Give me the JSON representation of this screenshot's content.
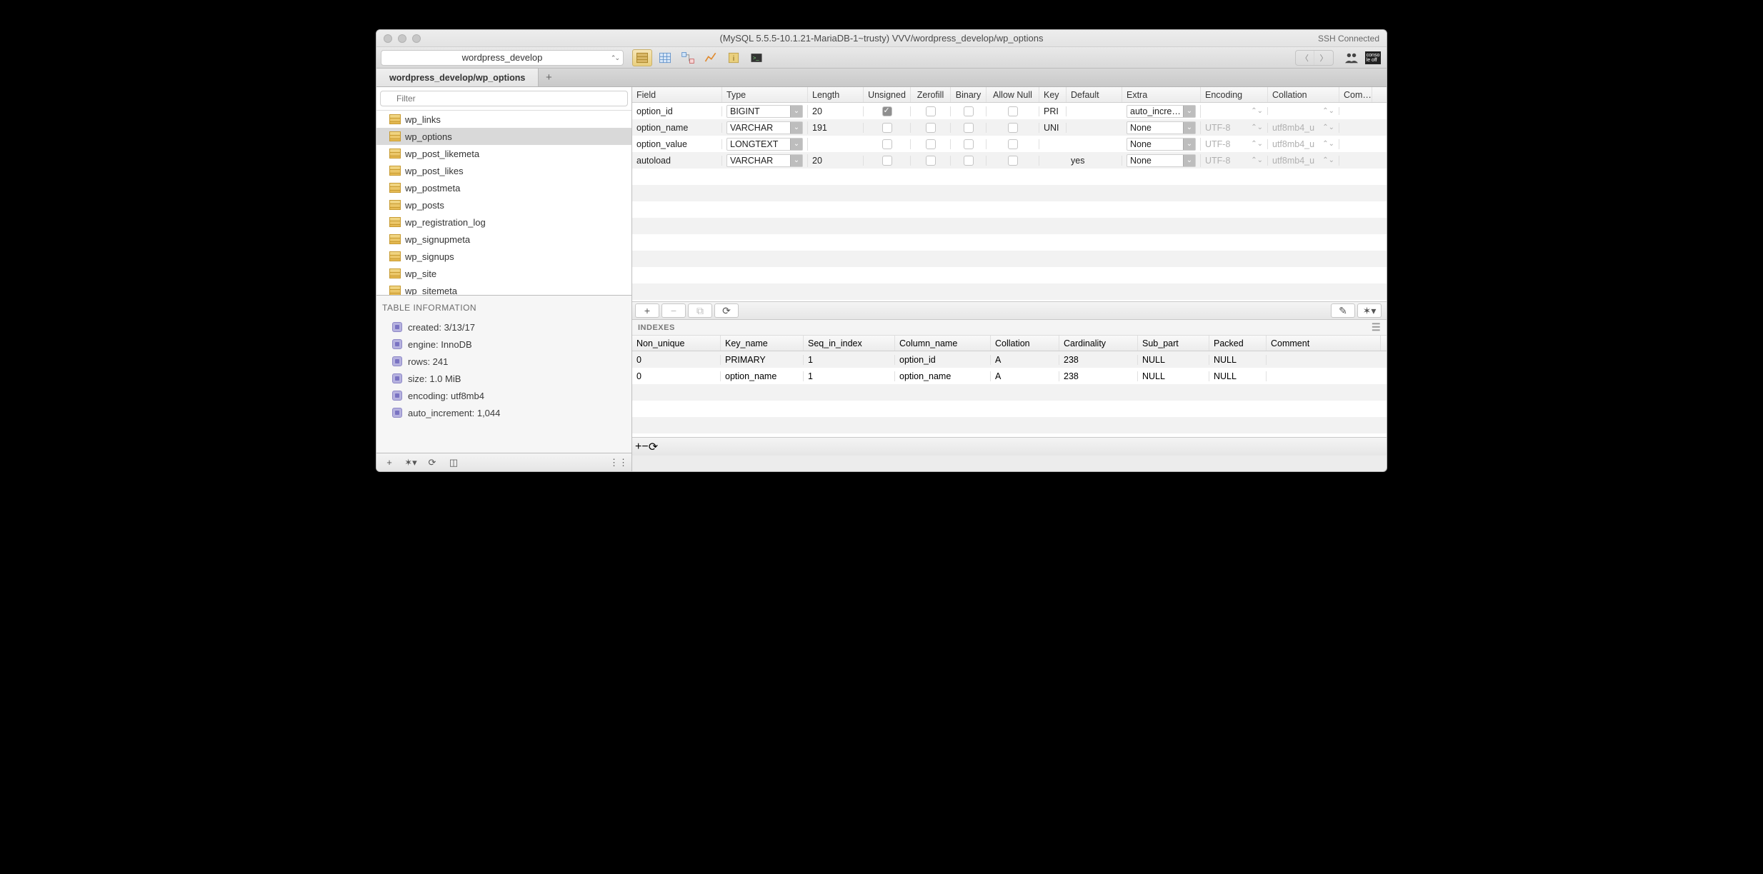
{
  "window": {
    "title": "(MySQL 5.5.5-10.1.21-MariaDB-1~trusty) VVV/wordpress_develop/wp_options",
    "ssh_status": "SSH Connected"
  },
  "toolbar": {
    "db_selected": "wordpress_develop"
  },
  "tab": {
    "label": "wordpress_develop/wp_options"
  },
  "sidebar": {
    "filter_placeholder": "Filter",
    "tables": [
      {
        "name": "wp_links",
        "selected": false
      },
      {
        "name": "wp_options",
        "selected": true
      },
      {
        "name": "wp_post_likemeta",
        "selected": false
      },
      {
        "name": "wp_post_likes",
        "selected": false
      },
      {
        "name": "wp_postmeta",
        "selected": false
      },
      {
        "name": "wp_posts",
        "selected": false
      },
      {
        "name": "wp_registration_log",
        "selected": false
      },
      {
        "name": "wp_signupmeta",
        "selected": false
      },
      {
        "name": "wp_signups",
        "selected": false
      },
      {
        "name": "wp_site",
        "selected": false
      },
      {
        "name": "wp_sitemeta",
        "selected": false
      }
    ],
    "info_title": "TABLE INFORMATION",
    "info": [
      {
        "label": "created: 3/13/17"
      },
      {
        "label": "engine: InnoDB"
      },
      {
        "label": "rows: 241"
      },
      {
        "label": "size: 1.0 MiB"
      },
      {
        "label": "encoding: utf8mb4"
      },
      {
        "label": "auto_increment: 1,044"
      }
    ]
  },
  "structure": {
    "headers": {
      "field": "Field",
      "type": "Type",
      "length": "Length",
      "unsigned": "Unsigned",
      "zerofill": "Zerofill",
      "binary": "Binary",
      "allow_null": "Allow Null",
      "key": "Key",
      "default": "Default",
      "extra": "Extra",
      "encoding": "Encoding",
      "collation": "Collation",
      "comment": "Com…"
    },
    "rows": [
      {
        "field": "option_id",
        "type": "BIGINT",
        "length": "20",
        "unsigned": true,
        "zerofill": false,
        "binary": false,
        "allow_null": false,
        "key": "PRI",
        "default": "",
        "extra": "auto_incre…",
        "encoding": "",
        "collation": ""
      },
      {
        "field": "option_name",
        "type": "VARCHAR",
        "length": "191",
        "unsigned": false,
        "zerofill": false,
        "binary": false,
        "allow_null": false,
        "key": "UNI",
        "default": "",
        "extra": "None",
        "encoding": "UTF-8",
        "collation": "utf8mb4_u"
      },
      {
        "field": "option_value",
        "type": "LONGTEXT",
        "length": "",
        "unsigned": false,
        "zerofill": false,
        "binary": false,
        "allow_null": false,
        "key": "",
        "default": "",
        "extra": "None",
        "encoding": "UTF-8",
        "collation": "utf8mb4_u"
      },
      {
        "field": "autoload",
        "type": "VARCHAR",
        "length": "20",
        "unsigned": false,
        "zerofill": false,
        "binary": false,
        "allow_null": false,
        "key": "",
        "default": "yes",
        "extra": "None",
        "encoding": "UTF-8",
        "collation": "utf8mb4_u"
      }
    ]
  },
  "indexes": {
    "title": "INDEXES",
    "headers": {
      "non_unique": "Non_unique",
      "key_name": "Key_name",
      "seq": "Seq_in_index",
      "col": "Column_name",
      "coll": "Collation",
      "card": "Cardinality",
      "sub": "Sub_part",
      "packed": "Packed",
      "comment": "Comment"
    },
    "rows": [
      {
        "nu": "0",
        "kn": "PRIMARY",
        "si": "1",
        "cn": "option_id",
        "co": "A",
        "ca": "238",
        "sp": "NULL",
        "pk": "NULL",
        "cm": ""
      },
      {
        "nu": "0",
        "kn": "option_name",
        "si": "1",
        "cn": "option_name",
        "co": "A",
        "ca": "238",
        "sp": "NULL",
        "pk": "NULL",
        "cm": ""
      }
    ]
  }
}
